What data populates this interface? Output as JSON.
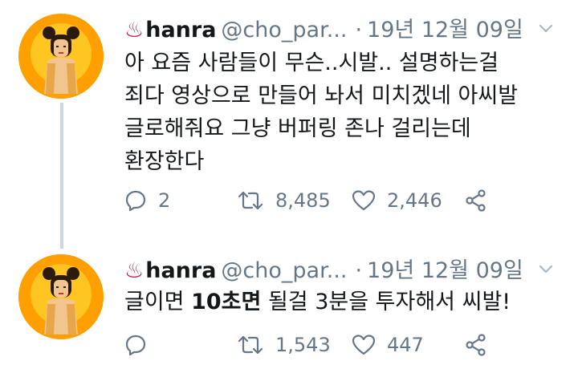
{
  "tweets": [
    {
      "emoji": "♨",
      "name": "hanra",
      "handle": "@cho_par...",
      "dot": "·",
      "date": "19년 12월 09일",
      "lines": [
        "아 요즘 사람들이 무슨..시발.. 설명하는걸",
        "죄다 영상으로 만들어 놔서 미치겠네 아씨발",
        "글로해줘요 그냥 버퍼링 존나 걸리는데",
        "환장한다"
      ],
      "replies": "2",
      "retweets": "8,485",
      "likes": "2,446"
    },
    {
      "emoji": "♨",
      "name": "hanra",
      "handle": "@cho_par...",
      "dot": "·",
      "date": "19년 12월 09일",
      "text_parts": [
        "글이면 ",
        "10초면",
        " 될걸 3분을 투자해서 씨발!"
      ],
      "replies": "",
      "retweets": "1,543",
      "likes": "447"
    }
  ],
  "colors": {
    "text": "#14171a",
    "muted": "#657786",
    "thread_line": "#ccd6dd",
    "emoji": "#c2185b",
    "avatar_bg": "#ffa000"
  },
  "icons": {
    "reply": "reply-icon",
    "retweet": "retweet-icon",
    "like": "heart-icon",
    "share": "share-icon",
    "more": "chevron-down-icon"
  }
}
